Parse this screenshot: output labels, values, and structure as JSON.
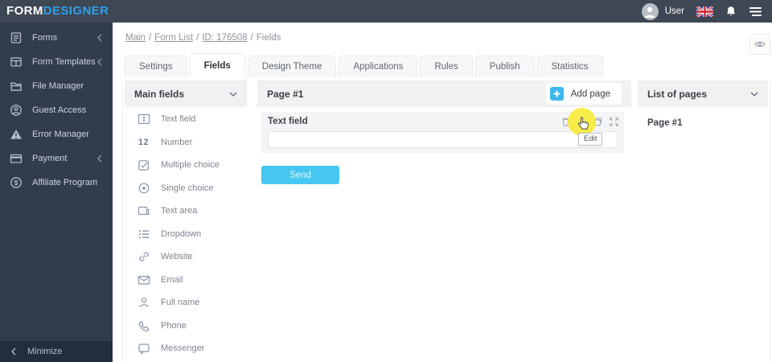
{
  "topbar": {
    "logo_primary": "FORM",
    "logo_designer": "DESIGNER",
    "user_label": "User"
  },
  "sidebar": {
    "items": [
      {
        "label": "Forms",
        "icon": "forms-icon",
        "has_chevron": true
      },
      {
        "label": "Form Templates",
        "icon": "form-templates-icon",
        "has_chevron": true
      },
      {
        "label": "File Manager",
        "icon": "file-manager-icon",
        "has_chevron": false
      },
      {
        "label": "Guest Access",
        "icon": "guest-access-icon",
        "has_chevron": false
      },
      {
        "label": "Error Manager",
        "icon": "error-manager-icon",
        "has_chevron": false
      },
      {
        "label": "Payment",
        "icon": "payment-icon",
        "has_chevron": true
      },
      {
        "label": "Affiliate Program",
        "icon": "affiliate-program-icon",
        "has_chevron": false
      }
    ],
    "minimize_label": "Minimize"
  },
  "breadcrumb": {
    "separator": "/",
    "parts": [
      {
        "label": "Main",
        "link": true
      },
      {
        "label": "Form List",
        "link": true
      },
      {
        "label": "ID: 176508",
        "link": true
      },
      {
        "label": "Fields",
        "link": false
      }
    ]
  },
  "tabs": [
    {
      "label": "Settings",
      "active": false
    },
    {
      "label": "Fields",
      "active": true
    },
    {
      "label": "Design Theme",
      "active": false
    },
    {
      "label": "Applications",
      "active": false
    },
    {
      "label": "Rules",
      "active": false
    },
    {
      "label": "Publish",
      "active": false
    },
    {
      "label": "Statistics",
      "active": false
    }
  ],
  "fields_panel": {
    "header": "Main fields",
    "items": [
      {
        "label": "Text field",
        "icon": "text-field-icon"
      },
      {
        "label": "Number",
        "icon": "number-icon",
        "icon_text": "12"
      },
      {
        "label": "Multiple choice",
        "icon": "multiple-choice-icon"
      },
      {
        "label": "Single choice",
        "icon": "single-choice-icon"
      },
      {
        "label": "Text area",
        "icon": "text-area-icon"
      },
      {
        "label": "Dropdown",
        "icon": "dropdown-icon"
      },
      {
        "label": "Website",
        "icon": "website-icon"
      },
      {
        "label": "Email",
        "icon": "email-icon"
      },
      {
        "label": "Full name",
        "icon": "full-name-icon"
      },
      {
        "label": "Phone",
        "icon": "phone-icon"
      },
      {
        "label": "Messenger",
        "icon": "messenger-icon"
      }
    ]
  },
  "canvas_panel": {
    "page_header": "Page #1",
    "add_page_label": "Add page",
    "field_label": "Text field",
    "field_value": "",
    "toolbar_icons": [
      "trash-icon",
      "edit-icon",
      "copy-icon",
      "expand-icon"
    ],
    "tooltip": "Edit",
    "send_label": "Send"
  },
  "pages_panel": {
    "header": "List of pages",
    "pages": [
      {
        "label": "Page #1"
      }
    ]
  },
  "colors": {
    "topbar_bg": "#3e4754",
    "sidebar_bg": "#323c4f",
    "logo_blue": "#2f9fe8",
    "accent_blue": "#47c6f2",
    "add_page_blue": "#3cb9ee",
    "highlight_yellow": "#f7ea39",
    "panel_header_bg": "#f0f1f3"
  }
}
